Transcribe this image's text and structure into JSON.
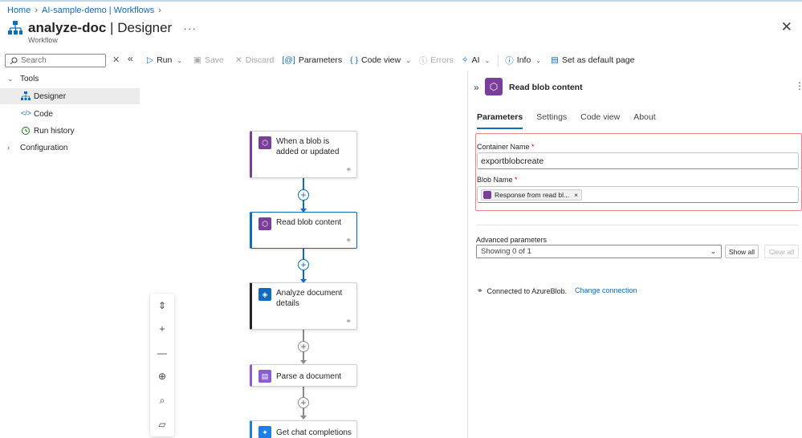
{
  "breadcrumb": {
    "home": "Home",
    "app": "AI-sample-demo | Workflows"
  },
  "header": {
    "name": "analyze-doc",
    "separator": " | ",
    "page": "Designer",
    "subtitle": "Workflow",
    "more": "···"
  },
  "sidebar": {
    "search_placeholder": "Search",
    "tools_label": "Tools",
    "items": [
      {
        "label": "Designer",
        "icon": "designer-icon",
        "selected": true
      },
      {
        "label": "Code",
        "icon": "code-icon",
        "selected": false
      },
      {
        "label": "Run history",
        "icon": "history-icon",
        "selected": false
      }
    ],
    "configuration_label": "Configuration"
  },
  "toolbar": {
    "run": "Run",
    "save": "Save",
    "discard": "Discard",
    "parameters": "Parameters",
    "code_view": "Code view",
    "errors": "Errors",
    "ai": "AI",
    "info": "Info",
    "set_default": "Set as default page"
  },
  "workflow": {
    "nodes": [
      {
        "title": "When a blob is added or updated",
        "icon": "blob-trigger-icon",
        "color": "#7a3f9b"
      },
      {
        "title": "Read blob content",
        "icon": "blob-icon",
        "color": "#7a3f9b"
      },
      {
        "title": "Analyze document details",
        "icon": "document-intelligence-icon",
        "color": "#0f6cbd"
      },
      {
        "title": "Parse a document",
        "icon": "parse-document-icon",
        "color": "#8c5cd4"
      },
      {
        "title": "Get chat completions",
        "icon": "openai-icon",
        "color": "#1c7ee6"
      }
    ]
  },
  "panel": {
    "title": "Read blob content",
    "tabs": [
      "Parameters",
      "Settings",
      "Code view",
      "About"
    ],
    "active_tab": "Parameters",
    "container_label": "Container Name",
    "container_value": "exportblobcreate",
    "blob_label": "Blob Name",
    "blob_token": "Response from read bl...",
    "required_mark": "*",
    "advanced_label": "Advanced parameters",
    "advanced_select": "Showing 0 of 1",
    "show_all": "Show all",
    "clear_all": "Clear all",
    "connection_text": "Connected to AzureBlob.",
    "change_connection": "Change connection"
  }
}
